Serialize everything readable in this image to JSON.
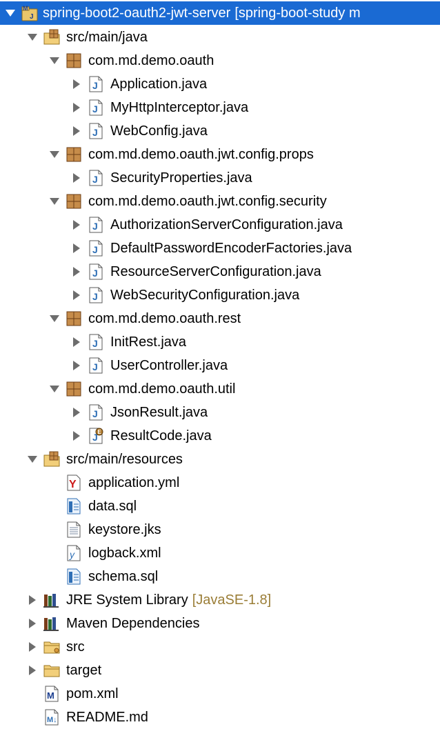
{
  "tree": {
    "project": {
      "label": "spring-boot2-oauth2-jwt-server",
      "decoration": "[spring-boot-study m"
    },
    "src_main_java": "src/main/java",
    "packages": [
      {
        "label": "com.md.demo.oauth",
        "files": [
          "Application.java",
          "MyHttpInterceptor.java",
          "WebConfig.java"
        ]
      },
      {
        "label": "com.md.demo.oauth.jwt.config.props",
        "files": [
          "SecurityProperties.java"
        ]
      },
      {
        "label": "com.md.demo.oauth.jwt.config.security",
        "files": [
          "AuthorizationServerConfiguration.java",
          "DefaultPasswordEncoderFactories.java",
          "ResourceServerConfiguration.java",
          "WebSecurityConfiguration.java"
        ]
      },
      {
        "label": "com.md.demo.oauth.rest",
        "files": [
          "InitRest.java",
          "UserController.java"
        ]
      },
      {
        "label": "com.md.demo.oauth.util",
        "files": [
          "JsonResult.java",
          "ResultCode.java"
        ]
      }
    ],
    "src_main_resources": "src/main/resources",
    "resources": [
      "application.yml",
      "data.sql",
      "keystore.jks",
      "logback.xml",
      "schema.sql"
    ],
    "jre": {
      "label": "JRE System Library",
      "decoration": "[JavaSE-1.8]"
    },
    "maven": "Maven Dependencies",
    "src": "src",
    "target": "target",
    "pom": "pom.xml",
    "readme": "README.md"
  },
  "colors": {
    "selection": "#1a6ad3",
    "decoration": "#9a7d36",
    "package": "#8b5a2b",
    "java_blue": "#2f6fb5"
  }
}
